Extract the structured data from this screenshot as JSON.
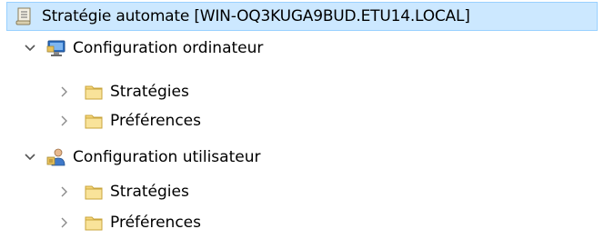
{
  "tree": {
    "root": {
      "label": "Stratégie automate [WIN-OQ3KUGA9BUD.ETU14.LOCAL]",
      "icon": "policy-scroll-icon"
    },
    "nodes": [
      {
        "label": "Configuration ordinateur",
        "icon": "computer-config-icon",
        "expanded": true,
        "children": [
          {
            "label": "Stratégies",
            "icon": "folder-icon",
            "expanded": false
          },
          {
            "label": "Préférences",
            "icon": "folder-icon",
            "expanded": false
          }
        ]
      },
      {
        "label": "Configuration utilisateur",
        "icon": "user-config-icon",
        "expanded": true,
        "children": [
          {
            "label": "Stratégies",
            "icon": "folder-icon",
            "expanded": false
          },
          {
            "label": "Préférences",
            "icon": "folder-icon",
            "expanded": false
          }
        ]
      }
    ]
  },
  "colors": {
    "selection_bg": "#cce8ff",
    "selection_border": "#99d1ff",
    "folder": "#f6d67a",
    "chevron": "#7a7a7a"
  }
}
